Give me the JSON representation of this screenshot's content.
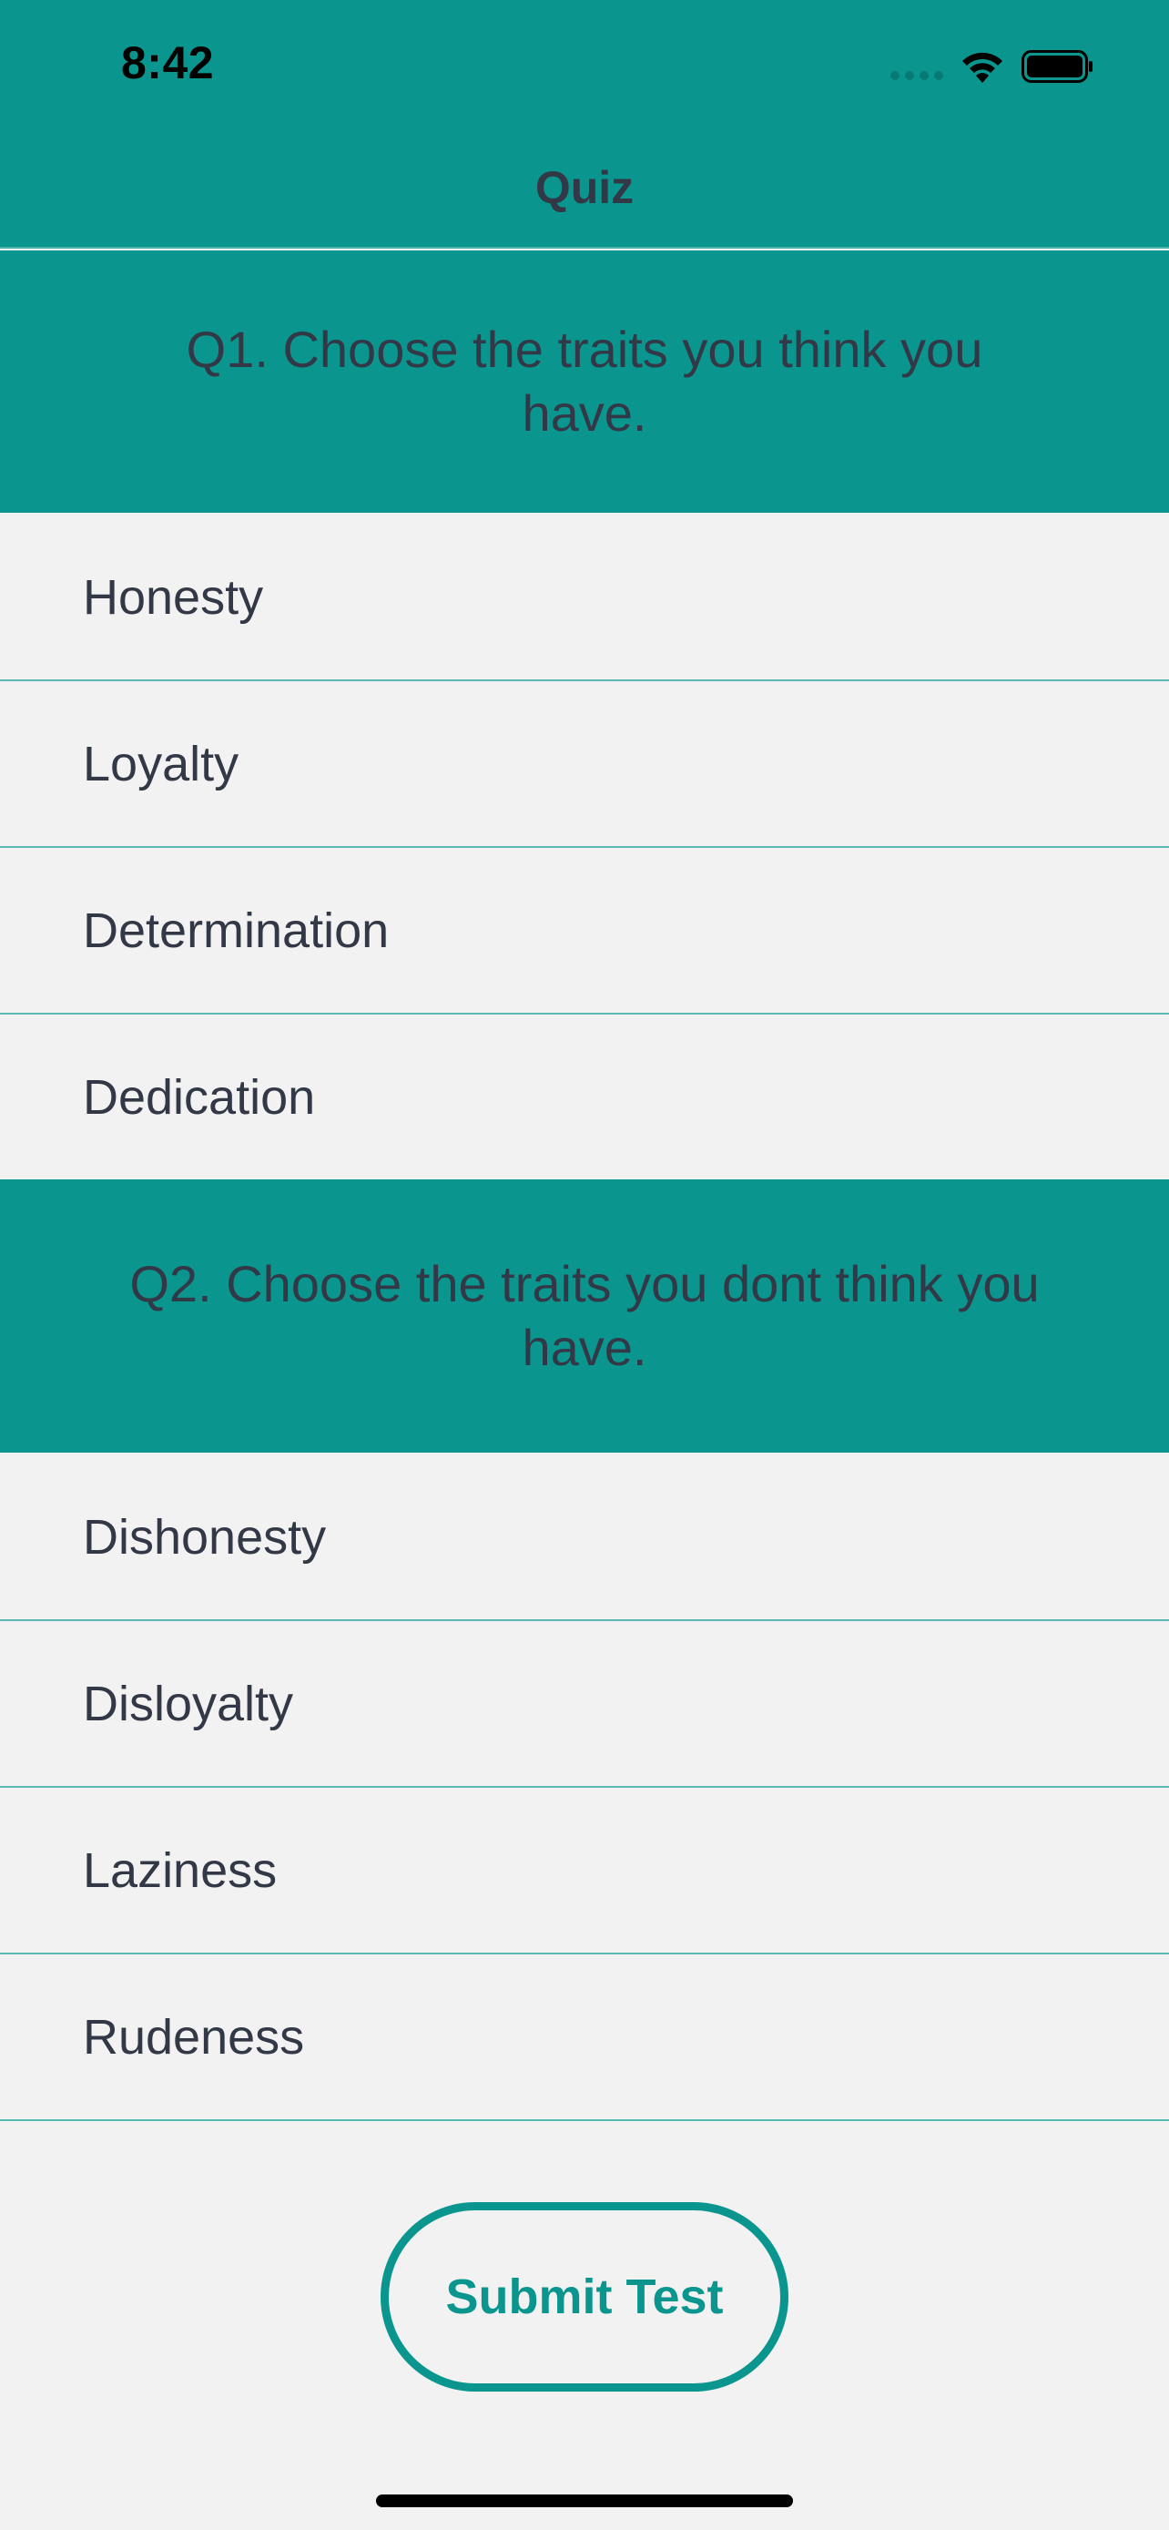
{
  "status_bar": {
    "time": "8:42",
    "icons": [
      "cellular-signal-icon",
      "wifi-icon",
      "battery-icon"
    ]
  },
  "nav": {
    "title": "Quiz"
  },
  "questions": [
    {
      "title": "Q1. Choose the traits you think you have.",
      "options": [
        "Honesty",
        "Loyalty",
        "Determination",
        "Dedication"
      ]
    },
    {
      "title": "Q2. Choose the traits you dont think you have.",
      "options": [
        "Dishonesty",
        "Disloyalty",
        "Laziness",
        "Rudeness"
      ]
    }
  ],
  "submit": {
    "label": "Submit Test"
  },
  "colors": {
    "accent": "#0a968e",
    "background": "#f2f2f2",
    "text": "#333846",
    "divider": "#5cbab4"
  }
}
